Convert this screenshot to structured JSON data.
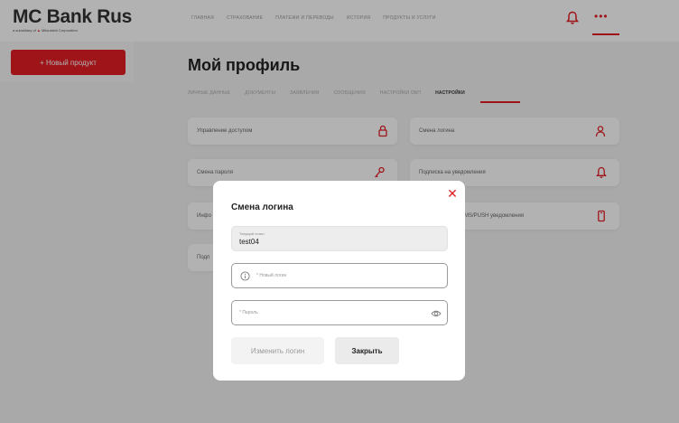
{
  "brand": {
    "title": "MC Bank Rus",
    "subtitle_prefix": "a subsidiary of",
    "subtitle_company": "Mitsubishi Corporation"
  },
  "nav": [
    "ГЛАВНАЯ",
    "СТРАХОВАНИЕ",
    "ПЛАТЕЖИ И ПЕРЕВОДЫ",
    "ИСТОРИЯ",
    "ПРОДУКТЫ И УСЛУГИ"
  ],
  "header": {
    "more_label": "•••"
  },
  "sidebar": {
    "new_product_label": "+ Новый продукт"
  },
  "page": {
    "title": "Мой профиль"
  },
  "tabs": [
    {
      "label": "ЛИЧНЫЕ ДАННЫЕ",
      "active": false
    },
    {
      "label": "ДОКУМЕНТЫ",
      "active": false
    },
    {
      "label": "ЗАЯВЛЕНИЯ",
      "active": false
    },
    {
      "label": "СООБЩЕНИЯ",
      "active": false
    },
    {
      "label": "НАСТРОЙКИ ОБП",
      "active": false
    },
    {
      "label": "НАСТРОЙКИ",
      "active": true
    }
  ],
  "cards": {
    "access": "Управление доступом",
    "login_change": "Смена логина",
    "password_change": "Смена пароля",
    "subscription": "Подписка на уведомления",
    "info": "Инфо",
    "sms": "SMS/PUSH уведомления",
    "sub": "Подп"
  },
  "modal": {
    "title": "Смена логина",
    "current_login_label": "Текущий логин",
    "current_login_value": "test04",
    "new_login_placeholder": "* Новый логин",
    "password_placeholder": "* Пароль",
    "submit_label": "Изменить логин",
    "close_label": "Закрыть"
  },
  "colors": {
    "accent": "#e31e24",
    "background": "#f2f2f2",
    "card": "#ffffff"
  }
}
